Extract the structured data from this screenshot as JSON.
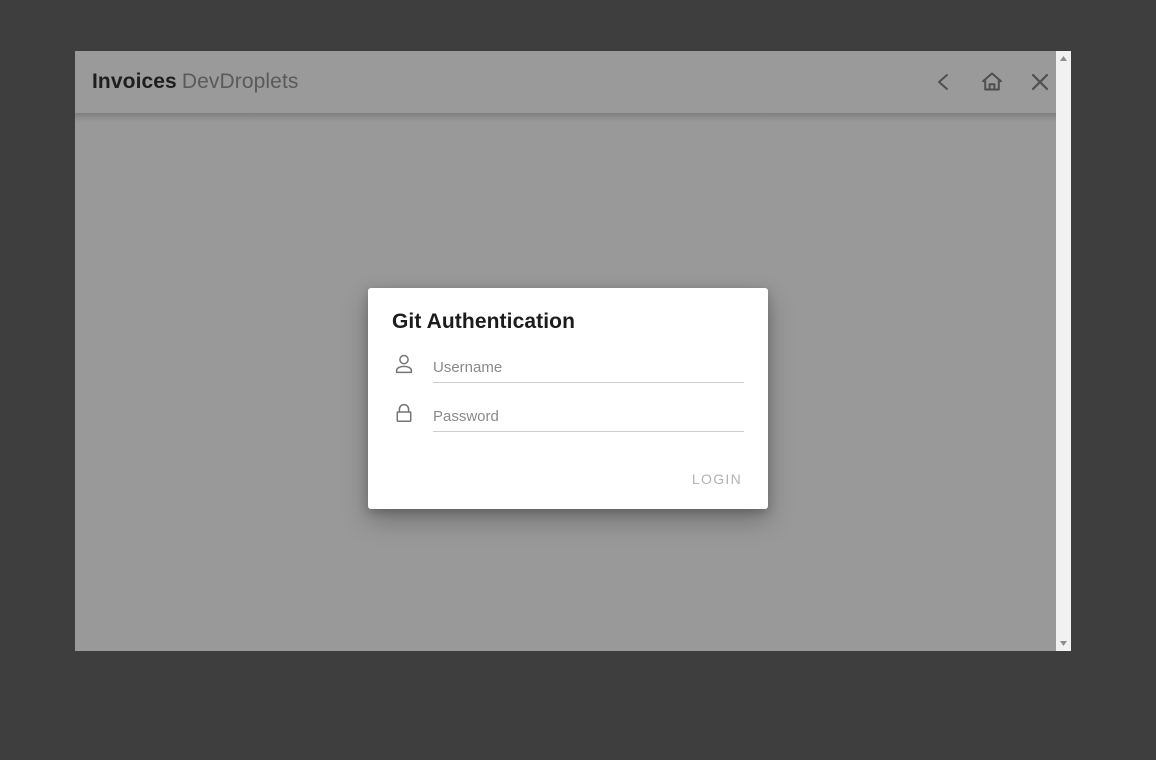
{
  "window": {
    "titlebar": {
      "app_name": "Invoices",
      "subtitle": "DevDroplets",
      "actions": [
        {
          "name": "back-button",
          "icon": "chevron-left-icon",
          "label": "Back"
        },
        {
          "name": "home-button",
          "icon": "home-icon",
          "label": "Home"
        },
        {
          "name": "close-button",
          "icon": "close-icon",
          "label": "Close"
        }
      ]
    }
  },
  "dialog": {
    "title": "Git Authentication",
    "fields": [
      {
        "name": "username-field",
        "icon": "person-icon",
        "placeholder": "Username",
        "value": ""
      },
      {
        "name": "password-field",
        "icon": "lock-icon",
        "placeholder": "Password",
        "value": ""
      }
    ],
    "login_label": "LOGIN"
  },
  "scrollbar": {
    "up_arrow": "triangle-up-icon",
    "down_arrow": "triangle-down-icon"
  },
  "colors": {
    "desktop_background": "#3e3e3e",
    "window_background": "#999999",
    "titlebar_background": "#9a9a9a",
    "dialog_background": "#ffffff",
    "title_text": "#1e1e1e",
    "subtitle_text": "#5a5a5a",
    "placeholder_text": "#8a8a8a",
    "underline": "#cccccc",
    "login_text": "#b3b3b3",
    "icon_gray": "#757575",
    "scrollbar_track": "#f1f1f1"
  }
}
